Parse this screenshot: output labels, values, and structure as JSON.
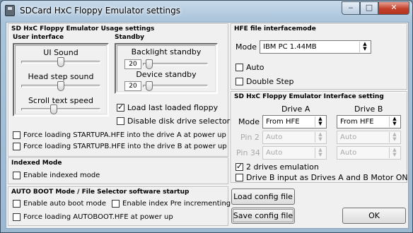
{
  "window": {
    "title": "SDCard HxC Floppy Emulator settings",
    "minimize": "‒",
    "maximize": "□",
    "close": "✕"
  },
  "usage": {
    "title": "SD HxC Floppy Emulator Usage settings",
    "user_interface": {
      "title": "User interface",
      "ui_sound": {
        "label": "UI Sound",
        "level": 0.5
      },
      "head_step_sound": {
        "label": "Head step sound",
        "level": 0.5
      },
      "scroll_text_speed": {
        "label": "Scroll text speed",
        "level": 0.4
      }
    },
    "standby": {
      "title": "Standby",
      "backlight": {
        "label": "Backlight standby",
        "value": "20",
        "level": 0.05
      },
      "device": {
        "label": "Device standby",
        "value": "20",
        "level": 0.05
      }
    },
    "load_last": {
      "label": "Load last loaded floppy",
      "checked": true
    },
    "disable_selector": {
      "label": "Disable disk drive selector",
      "checked": false
    },
    "force_a": {
      "label": "Force loading STARTUPA.HFE into the drive A at power up",
      "checked": false
    },
    "force_b": {
      "label": "Force loading STARTUPB.HFE into the drive B at power up",
      "checked": false
    }
  },
  "indexed": {
    "title": "Indexed Mode",
    "enable": {
      "label": "Enable indexed mode",
      "checked": false
    }
  },
  "autoboot": {
    "title": "AUTO BOOT Mode / File Selector software startup",
    "enable_auto": {
      "label": "Enable auto boot mode",
      "checked": false
    },
    "index_pre": {
      "label": "Enable index Pre incrementing",
      "checked": false
    },
    "force_autoboot": {
      "label": "Force loading AUTOBOOT.HFE at power up",
      "checked": false
    }
  },
  "hfe": {
    "title": "HFE file interfacemode",
    "mode_label": "Mode",
    "mode_value": "IBM PC 1.44MB",
    "auto": {
      "label": "Auto",
      "checked": false
    },
    "double_step": {
      "label": "Double Step",
      "checked": false
    }
  },
  "interface": {
    "title": "SD HxC Floppy Emulator Interface setting",
    "drive_a": "Drive A",
    "drive_b": "Drive B",
    "rows": [
      {
        "label": "Mode",
        "a": "From HFE",
        "b": "From HFE",
        "enabled": true
      },
      {
        "label": "Pin 2",
        "a": "Auto",
        "b": "Auto",
        "enabled": false
      },
      {
        "label": "Pin 34",
        "a": "Auto",
        "b": "Auto",
        "enabled": false
      }
    ],
    "two_drives": {
      "label": "2 drives emulation",
      "checked": true
    },
    "drive_b_input": {
      "label": "Drive B input as Drives A and B Motor ON",
      "checked": false
    }
  },
  "buttons": {
    "load": "Load config file",
    "save": "Save config file",
    "ok": "OK"
  }
}
